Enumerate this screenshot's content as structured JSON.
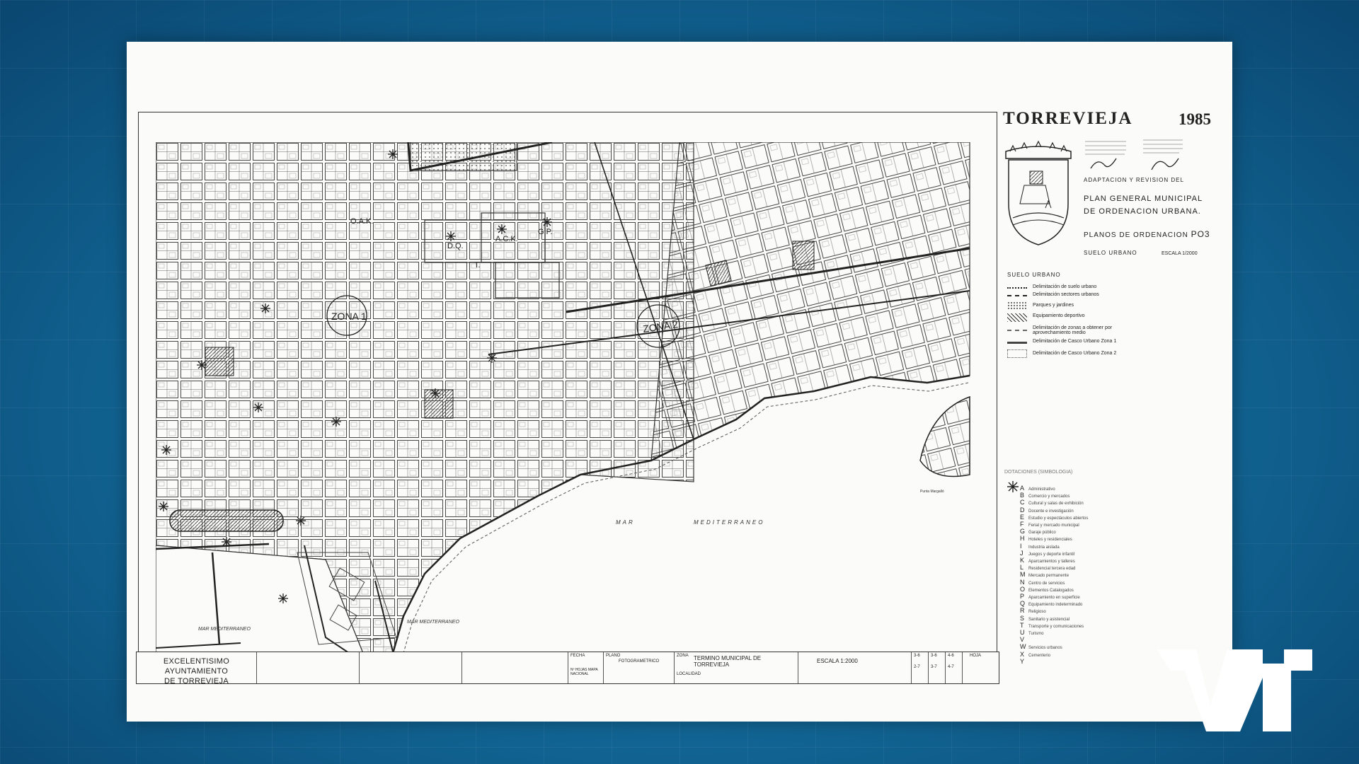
{
  "map": {
    "title": "TORREVIEJA",
    "year": "1985",
    "stamp_text": "ADAPTACION   Y   REVISION   DEL",
    "plan_line1": "PLAN  GENERAL  MUNICIPAL",
    "plan_line2": "DE  ORDENACION  URBANA.",
    "planos": "PLANOS   DE   ORDENACION",
    "planos_code": "PO3",
    "suelo_urbano": "SUELO  URBANO",
    "escala_small": "ESCALA     1/2000",
    "legend_header": "SUELO   URBANO",
    "legend_items": [
      "Delimitación  de  suelo  urbano",
      "Delimitación  sectores  urbanos",
      "Parques  y  jardines",
      "Equipamiento  deportivo",
      "Delimitación  de  zonas  a  obtener  por aprovechamiento  medio",
      "Delimitación  de  Casco  Urbano  Zona 1",
      "Delimitación  de  Casco  Urbano  Zona 2"
    ],
    "dotaciones_header": "DOTACIONES  (SIMBOLOGIA)",
    "dotaciones": [
      {
        "letter": "A",
        "label": "Administrativo"
      },
      {
        "letter": "B",
        "label": "Comercio  y  mercados"
      },
      {
        "letter": "C",
        "label": "Cultural  y  salas de exhibición"
      },
      {
        "letter": "D",
        "label": "Docente  e  investigación"
      },
      {
        "letter": "E",
        "label": "Estudio  y  espectáculos  abiertos"
      },
      {
        "letter": "F",
        "label": "Ferial  y  mercado  municipal"
      },
      {
        "letter": "G",
        "label": "Garaje  público"
      },
      {
        "letter": "H",
        "label": "Hoteles  y  residenciales"
      },
      {
        "letter": "I",
        "label": "Industria  aislada"
      },
      {
        "letter": "J",
        "label": "Juegos  y  deporte  infantil"
      },
      {
        "letter": "K",
        "label": "Aparcamientos  y  talleres"
      },
      {
        "letter": "L",
        "label": "Residencial  tercera edad"
      },
      {
        "letter": "M",
        "label": "Mercado  permanente"
      },
      {
        "letter": "N",
        "label": "Centro  de  servicios"
      },
      {
        "letter": "O",
        "label": "Elementos  Catalogados"
      },
      {
        "letter": "P",
        "label": "Aparcamiento  en superficie"
      },
      {
        "letter": "Q",
        "label": "Equipamiento  indeterminado"
      },
      {
        "letter": "R",
        "label": "Religioso"
      },
      {
        "letter": "S",
        "label": "Sanitario  y  asistencial"
      },
      {
        "letter": "T",
        "label": "Transporte  y  comunicaciones"
      },
      {
        "letter": "U",
        "label": "Turismo"
      },
      {
        "letter": "V",
        "label": ""
      },
      {
        "letter": "W",
        "label": "Servicios  urbanos"
      },
      {
        "letter": "X",
        "label": "Cementerio"
      },
      {
        "letter": "Y",
        "label": ""
      }
    ],
    "zones": [
      "ZONA 1",
      "ZONA 2"
    ],
    "sea_labels": [
      "MAR",
      "MEDITERRANEO",
      "MAR  MEDITERRANEO",
      "MAR  MEDITERRANEO"
    ],
    "place_labels": [
      "D.Q.",
      "A.C.K.",
      "G.P.",
      "T.",
      "O.A.K."
    ],
    "punta": "Punta  Margalló",
    "title_block": {
      "council_line1": "EXCELENTISIMO  AYUNTAMIENTO",
      "council_line2": "DE  TORREVIEJA",
      "fecha": "FECHA",
      "plano": "PLANO",
      "fotogrametrico": "FOTOGRAMETRICO",
      "zona": "ZONA",
      "termino": "TERMINO  MUNICIPAL  DE  TORREVIEJA",
      "localidad": "LOCALIDAD",
      "escala": "ESCALA   1:2000",
      "hojas": "HOJA",
      "mapa_nacional": "Nº HOJAS  MAPA  NACIONAL",
      "sheets": [
        "3-6",
        "3-6",
        "4-6",
        "2-7",
        "3-7",
        "4-7"
      ]
    }
  },
  "channel_logo": "TVT",
  "colors": {
    "background": "#1a7bab",
    "paper": "#fbfbfa",
    "ink": "#222222"
  }
}
